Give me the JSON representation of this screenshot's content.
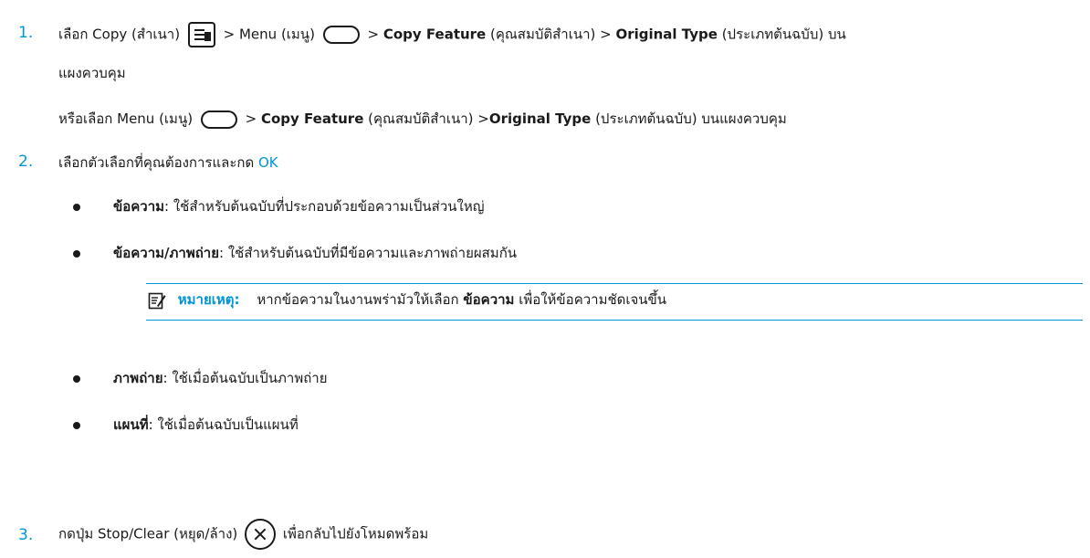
{
  "step1": {
    "number": "1.",
    "a": "เลือก Copy (สำเนา)",
    "b": "> Menu (เมนู)",
    "c": "> ",
    "copy_feature": "Copy Feature",
    "d": " (คุณสมบัติสำเนา) > ",
    "original_type": "Original Type",
    "e": " (ประเภทต้นฉบับ) บน",
    "line2": "แผงควบคุม",
    "alt_a": "หรือเลือก Menu (เมนู)",
    "alt_b": "> ",
    "alt_copy_feature": "Copy Feature",
    "alt_c": " (คุณสมบัติสำเนา) >",
    "alt_original_type": "Original Type",
    "alt_d": " (ประเภทต้นฉบับ) บนแผงควบคุม"
  },
  "step2": {
    "number": "2.",
    "text": "เลือกตัวเลือกที่คุณต้องการและกด ",
    "ok": "OK",
    "options": [
      {
        "term": "ข้อความ",
        "desc": ": ใช้สำหรับต้นฉบับที่ประกอบด้วยข้อความเป็นส่วนใหญ่"
      },
      {
        "term": "ข้อความ/ภาพถ่าย",
        "desc": ": ใช้สำหรับต้นฉบับที่มีข้อความและภาพถ่ายผสมกัน"
      },
      {
        "term": "ภาพถ่าย",
        "desc": ": ใช้เมื่อต้นฉบับเป็นภาพถ่าย"
      },
      {
        "term": "แผนที่",
        "desc": ": ใช้เมื่อต้นฉบับเป็นแผนที่"
      }
    ],
    "note": {
      "label": "หมายเหตุ:",
      "text_a": "หากข้อความในงานพร่ามัวให้เลือก ",
      "term": "ข้อความ",
      "text_b": " เพื่อให้ข้อความชัดเจนขึ้น"
    }
  },
  "step3": {
    "number": "3.",
    "a": "กดปุ่ม Stop/Clear (หยุด/ล้าง)",
    "b": "เพื่อกลับไปยังโหมดพร้อม"
  }
}
